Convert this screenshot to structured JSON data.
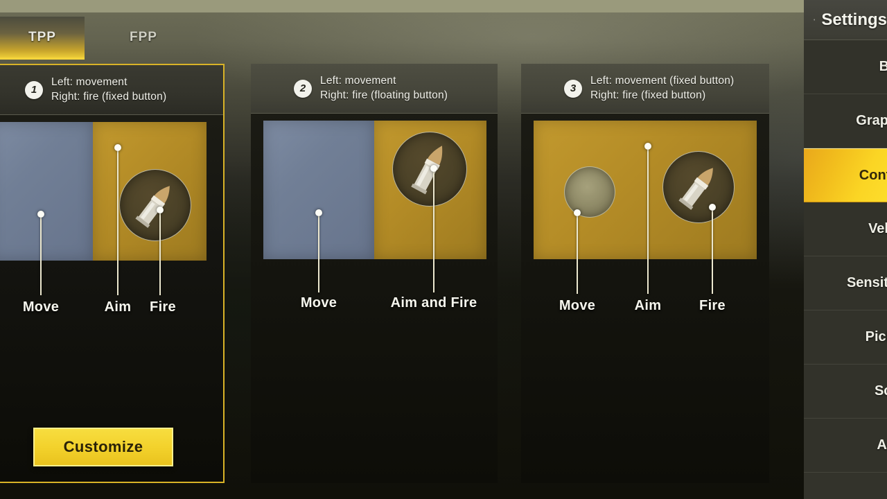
{
  "tabs": [
    {
      "id": "tpp",
      "label": "TPP",
      "active": true
    },
    {
      "id": "fpp",
      "label": "FPP",
      "active": false
    }
  ],
  "cards": [
    {
      "number": "1",
      "line1": "Left: movement",
      "line2": "Right: fire (fixed button)",
      "selected": true,
      "captions": [
        "Move",
        "Aim",
        "Fire"
      ],
      "button_label": "Customize"
    },
    {
      "number": "2",
      "line1": "Left: movement",
      "line2": "Right: fire (floating button)",
      "selected": false,
      "captions": [
        "Move",
        "Aim and Fire"
      ]
    },
    {
      "number": "3",
      "line1": "Left: movement (fixed button)",
      "line2": "Right: fire (fixed button)",
      "selected": false,
      "captions": [
        "Move",
        "Aim",
        "Fire"
      ]
    }
  ],
  "sidebar": {
    "title": "Settings",
    "icon": "gear-icon",
    "items": [
      {
        "label": "Basic",
        "active": false
      },
      {
        "label": "Graphics",
        "active": false
      },
      {
        "label": "Controls",
        "active": true
      },
      {
        "label": "Vehicle",
        "active": false
      },
      {
        "label": "Sensitivity",
        "active": false
      },
      {
        "label": "Pick Up",
        "active": false
      },
      {
        "label": "Scope",
        "active": false
      },
      {
        "label": "Audio",
        "active": false
      }
    ]
  },
  "colors": {
    "accent_gold": "#f3d22c",
    "selected_border": "#d9b327",
    "move_pane": "#717f96",
    "fire_pane": "#b38b26",
    "panel_dark": "#15150f",
    "sidebar_bg": "#33332b"
  }
}
